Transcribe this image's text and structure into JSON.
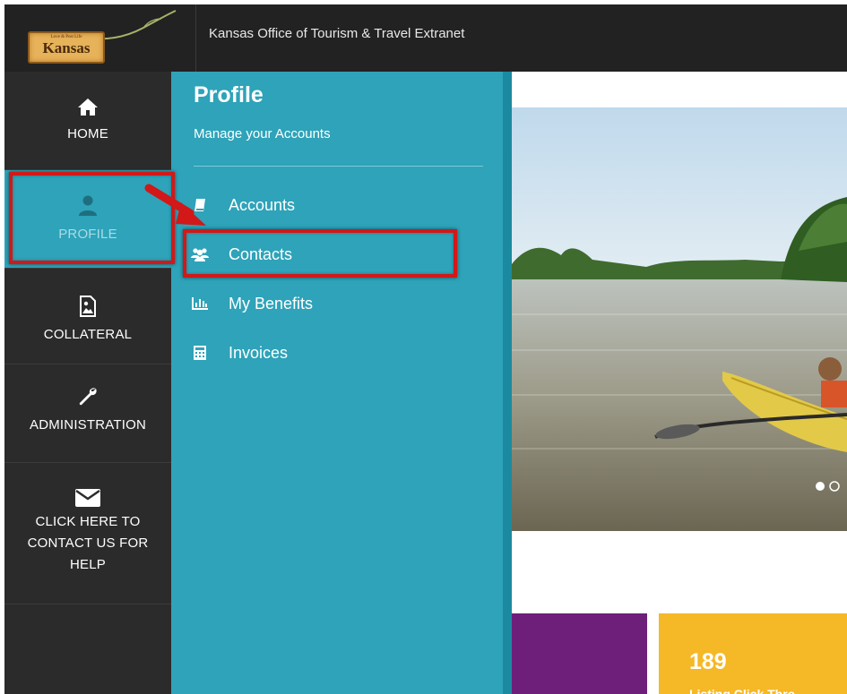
{
  "header": {
    "site_title": "Kansas Office of Tourism & Travel Extranet",
    "logo": {
      "tagline": "Love & Post Life",
      "wordmark": "Kansas"
    }
  },
  "sidebar": {
    "items": [
      {
        "key": "home",
        "label": "HOME",
        "icon": "home-icon"
      },
      {
        "key": "profile",
        "label": "PROFILE",
        "icon": "user-icon",
        "active": true
      },
      {
        "key": "collateral",
        "label": "COLLATERAL",
        "icon": "image-file-icon"
      },
      {
        "key": "administration",
        "label": "ADMINISTRATION",
        "icon": "wrench-icon"
      },
      {
        "key": "help",
        "label_lines": [
          "CLICK HERE TO",
          "CONTACT US FOR",
          "HELP"
        ],
        "icon": "envelope-icon"
      }
    ]
  },
  "profile_panel": {
    "title": "Profile",
    "subtitle": "Manage your Accounts",
    "menu": [
      {
        "label": "Accounts",
        "icon": "book-icon"
      },
      {
        "label": "Contacts",
        "icon": "users-icon"
      },
      {
        "label": "My Benefits",
        "icon": "bar-chart-icon"
      },
      {
        "label": "Invoices",
        "icon": "calculator-icon"
      }
    ]
  },
  "content": {
    "hero_alt": "kayak-on-river-image",
    "tiles": [
      {
        "color": "#6d1f7a"
      },
      {
        "color": "#f5b826",
        "value": "189",
        "label": "Listing Click Thro"
      }
    ]
  },
  "colors": {
    "topbar": "#222222",
    "sidebar": "#2b2b2b",
    "accent_teal": "#2ea3b9",
    "highlight_red": "#d21818"
  }
}
